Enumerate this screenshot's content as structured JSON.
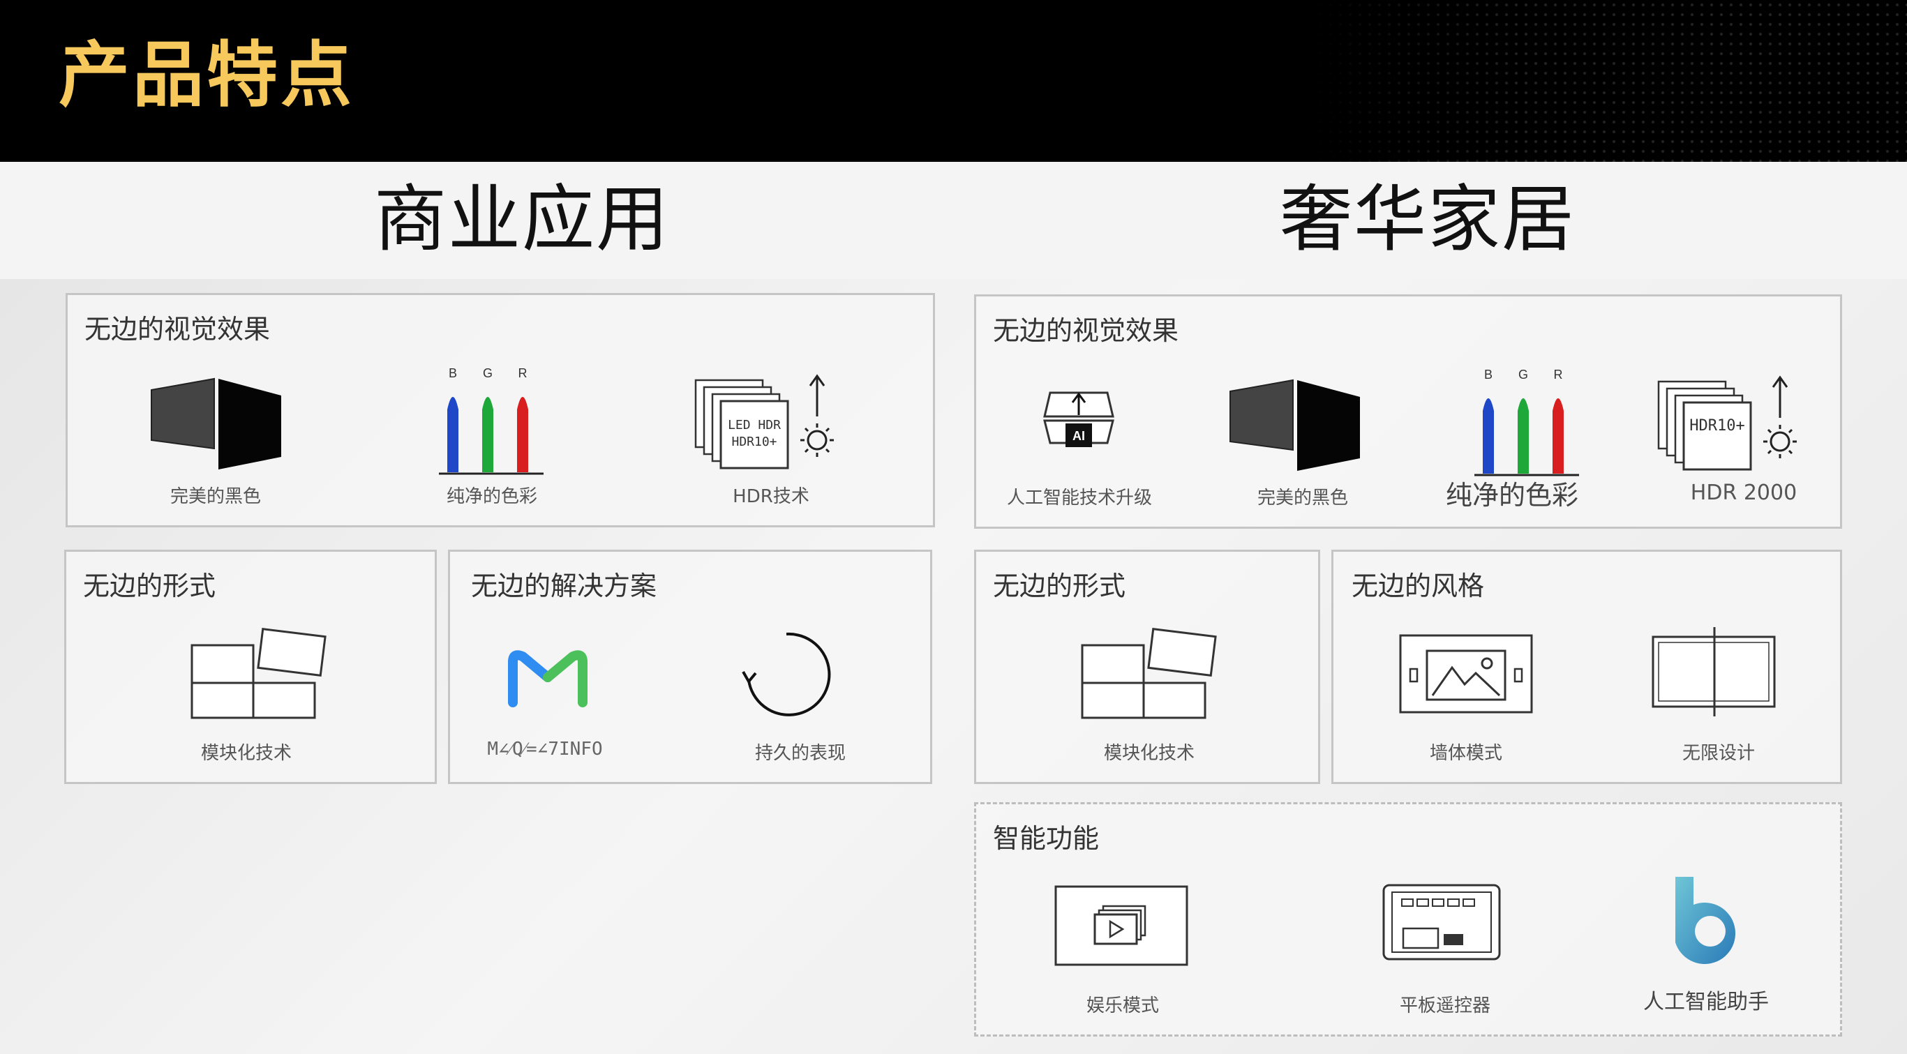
{
  "header": {
    "title": "产品特点"
  },
  "sections": {
    "left": {
      "title": "商业应用"
    },
    "right": {
      "title": "奢华家居"
    }
  },
  "left": {
    "visual": {
      "title": "无边的视觉效果",
      "items": [
        {
          "label": "完美的黑色",
          "icon": "black-screens-icon"
        },
        {
          "label": "纯净的色彩",
          "icon": "rgb-color-icon",
          "bgr": [
            "B",
            "G",
            "R"
          ]
        },
        {
          "label": "HDR技术",
          "icon": "hdr-icon",
          "badge_lines": [
            "LED HDR",
            "HDR10+"
          ]
        }
      ]
    },
    "form": {
      "title": "无边的形式",
      "items": [
        {
          "label": "模块化技术",
          "icon": "modular-screens-icon"
        }
      ]
    },
    "solution": {
      "title": "无边的解决方案",
      "items": [
        {
          "label": "M∠⁄Q⁄=∠7INFO",
          "icon": "magicinfo-logo-icon"
        },
        {
          "label": "持久的表现",
          "icon": "circular-arrow-icon"
        }
      ]
    }
  },
  "right": {
    "visual": {
      "title": "无边的视觉效果",
      "items": [
        {
          "label": "人工智能技术升级",
          "icon": "ai-upscale-icon",
          "chip": "AI"
        },
        {
          "label": "完美的黑色",
          "icon": "black-screens-icon"
        },
        {
          "label": "纯净的色彩",
          "icon": "rgb-color-icon",
          "bgr": [
            "B",
            "G",
            "R"
          ]
        },
        {
          "label": "HDR  2000",
          "icon": "hdr-icon",
          "badge_lines": [
            "HDR10+"
          ]
        }
      ]
    },
    "form": {
      "title": "无边的形式",
      "items": [
        {
          "label": "模块化技术",
          "icon": "modular-screens-icon"
        }
      ]
    },
    "style": {
      "title": "无边的风格",
      "items": [
        {
          "label": "墙体模式",
          "icon": "wall-mode-icon"
        },
        {
          "label": "无限设计",
          "icon": "infinity-design-icon"
        }
      ]
    },
    "smart": {
      "title": "智能功能",
      "items": [
        {
          "label": "娱乐模式",
          "icon": "entertainment-mode-icon"
        },
        {
          "label": "平板遥控器",
          "icon": "tablet-remote-icon"
        },
        {
          "label": "人工智能助手",
          "icon": "bixby-assistant-icon"
        }
      ]
    }
  },
  "colors": {
    "title_gold": "#f7c95c",
    "header_bg": "#000000",
    "blue": "#1e48c8",
    "green": "#1ea83a",
    "red": "#d81e1e",
    "magicinfo_blue": "#2f8cf0",
    "magicinfo_green": "#4cc05a"
  }
}
